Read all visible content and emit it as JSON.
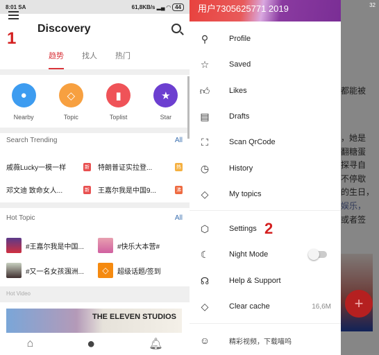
{
  "left": {
    "status": {
      "time": "8:01 SA",
      "speed": "61,8KB/s",
      "battery": "44"
    },
    "step_marker": "1",
    "title": "Discovery",
    "tabs": [
      {
        "label": "趋势",
        "active": true
      },
      {
        "label": "找人"
      },
      {
        "label": "热门"
      }
    ],
    "shortcuts": [
      {
        "label": "Nearby",
        "icon": "location-pin-icon",
        "color": "#3d9cf0"
      },
      {
        "label": "Topic",
        "icon": "diamond-icon",
        "color": "#f7a040"
      },
      {
        "label": "Toplist",
        "icon": "bar-chart-icon",
        "color": "#ef5358"
      },
      {
        "label": "Star",
        "icon": "star-icon",
        "color": "#6c3fd0"
      }
    ],
    "search_trending": {
      "title": "Search Trending",
      "all": "All",
      "items": [
        {
          "text": "戚薇Lucky一模一样",
          "badge": "新",
          "color": "#e85050"
        },
        {
          "text": "特朗普证实拉登...",
          "badge": "热",
          "color": "#f5b040"
        },
        {
          "text": "邓文迪 致命女人...",
          "badge": "新",
          "color": "#e85050"
        },
        {
          "text": "王嘉尔我是中国9...",
          "badge": "沸",
          "color": "#ee6a40"
        }
      ]
    },
    "hot_topic": {
      "title": "Hot Topic",
      "all": "All",
      "items": [
        {
          "text": "#王嘉尔我是中国..."
        },
        {
          "text": "#快乐大本营#"
        },
        {
          "text": "#又一名女孩涠洲..."
        },
        {
          "text": "超级话题/签到"
        }
      ]
    },
    "hot_video": {
      "title": "Hot Video",
      "thumb_text": "THE ELEVEN STUDIOS"
    },
    "nav": [
      {
        "icon": "home-icon"
      },
      {
        "icon": "planet-icon"
      },
      {
        "icon": "bell-icon"
      }
    ]
  },
  "right": {
    "drawer_header": "用户7305625771 2019",
    "status": {
      "battery": "32"
    },
    "step_marker": "2",
    "items": [
      {
        "label": "Profile",
        "icon": "user-icon"
      },
      {
        "label": "Saved",
        "icon": "star-icon"
      },
      {
        "label": "Likes",
        "icon": "thumbs-up-icon"
      },
      {
        "label": "Drafts",
        "icon": "draft-icon"
      },
      {
        "label": "Scan QrCode",
        "icon": "scan-icon"
      },
      {
        "label": "History",
        "icon": "clock-icon"
      },
      {
        "label": "My topics",
        "icon": "diamond-icon"
      }
    ],
    "settings_items": [
      {
        "label": "Settings",
        "icon": "settings-icon"
      },
      {
        "label": "Night Mode",
        "icon": "moon-icon",
        "toggle": false
      },
      {
        "label": "Help & Support",
        "icon": "headset-icon"
      },
      {
        "label": "Clear cache",
        "icon": "eraser-icon",
        "value": "16,6M"
      }
    ],
    "footer": {
      "label": "精彩视频，下载喵呜",
      "icon": "cat-icon"
    },
    "background_text": [
      "都能被",
      "，她是",
      "翻糖蛋",
      "探寻自",
      "不停歇",
      "的生日，",
      "娱乐，",
      "或者签"
    ]
  }
}
